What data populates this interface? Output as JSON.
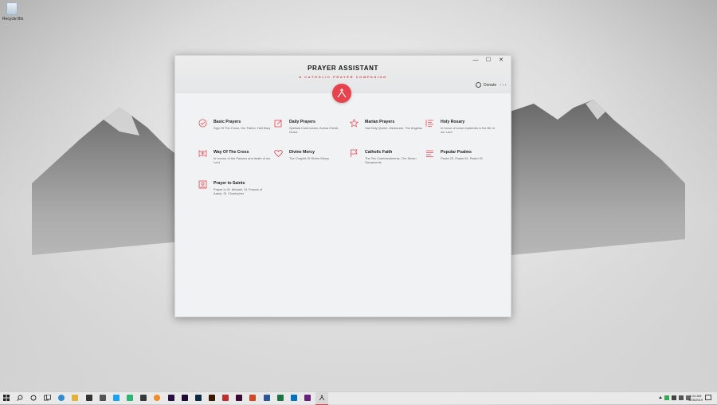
{
  "desktop": {
    "recycle_bin_label": "Recycle Bin"
  },
  "window": {
    "controls": {
      "minimize": "—",
      "maximize": "☐",
      "close": "✕"
    },
    "title": "PRAYER ASSISTANT",
    "subtitle": "A CATHOLIC PRAYER COMPANION",
    "donate_label": "Donate",
    "more_label": "···",
    "accent_color": "#e8434d"
  },
  "categories": [
    {
      "name": "Basic Prayers",
      "desc": "Sign Of The Cross, Our Father, Hail Mary",
      "icon": "check-circle-icon"
    },
    {
      "name": "Daily Prayers",
      "desc": "Spiritual Communion, Anima Christi, Grace",
      "icon": "edit-icon"
    },
    {
      "name": "Marian Prayers",
      "desc": "Hail Holy Queen, Memorare, The Angelus",
      "icon": "star-icon"
    },
    {
      "name": "Holy Rosary",
      "desc": "In honor of some mysteries in the life of our Lord",
      "icon": "list-icon"
    },
    {
      "name": "Way Of The Cross",
      "desc": "In honour of the Passion and death of our Lord",
      "icon": "cross-frame-icon"
    },
    {
      "name": "Divine Mercy",
      "desc": "The Chaplet Of Divine Mercy",
      "icon": "heart-icon"
    },
    {
      "name": "Catholic Faith",
      "desc": "The Ten Commandments, The Seven Sacraments",
      "icon": "flag-icon"
    },
    {
      "name": "Popular Psalms",
      "desc": "Psalm 23, Psalm 51, Psalm 91",
      "icon": "lines-icon"
    },
    {
      "name": "Prayer to Saints",
      "desc": "Prayer to St. Michael, St. Francis of Assisi, St. Christopher",
      "icon": "portrait-icon"
    }
  ],
  "taskbar": {
    "time": "1:24 AM",
    "date": "4/25/2019"
  }
}
